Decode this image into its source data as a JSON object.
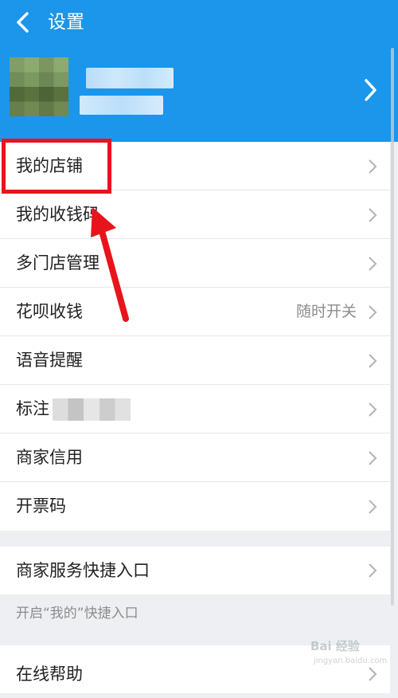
{
  "header": {
    "title": "设置",
    "color": "#1b96ea"
  },
  "menu": {
    "items": [
      {
        "label": "我的店铺",
        "value": ""
      },
      {
        "label": "我的收钱码",
        "value": ""
      },
      {
        "label": "多门店管理",
        "value": ""
      },
      {
        "label": "花呗收钱",
        "value": "随时开关"
      },
      {
        "label": "语音提醒",
        "value": ""
      },
      {
        "label": "标注",
        "value": ""
      },
      {
        "label": "商家信用",
        "value": ""
      },
      {
        "label": "开票码",
        "value": ""
      }
    ]
  },
  "shortcut": {
    "label": "商家服务快捷入口",
    "hint": "开启“我的”快捷入口"
  },
  "help": {
    "label": "在线帮助"
  },
  "annotation": {
    "color": "#e8141b"
  },
  "watermark": {
    "brand": "Bai 经验",
    "url": "jingyan.baidu.com"
  }
}
